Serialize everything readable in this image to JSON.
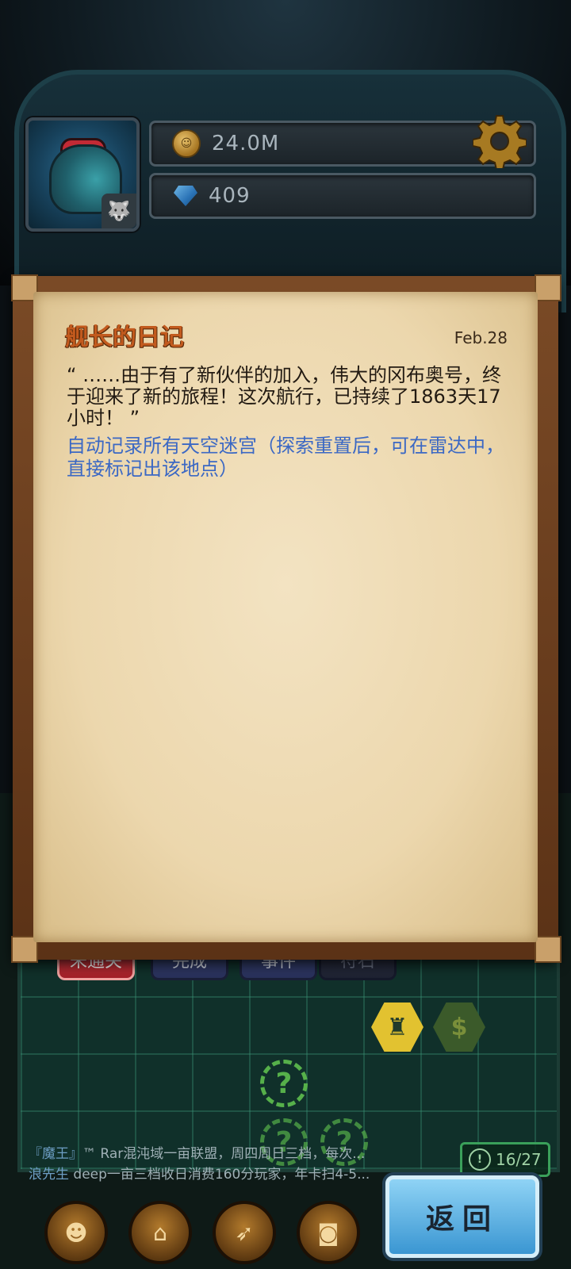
{
  "header": {
    "gold_value": "24.0M",
    "gem_value": "409",
    "icons": [
      "coin-icon",
      "gem-icon",
      "gear-icon",
      "wolf-badge-icon"
    ]
  },
  "diary": {
    "title": "舰长的日记",
    "date": "Feb.28",
    "text": "“ ……由于有了新伙伴的加入，伟大的冈布奥号，终于迎来了新的旅程！这次航行，已持续了1863天17小时！ ”",
    "note": "自动记录所有天空迷宫（探索重置后，可在雷达中，直接标记出该地点）"
  },
  "tabs": [
    {
      "label": "未通关",
      "state": "active"
    },
    {
      "label": "完成",
      "state": "normal"
    },
    {
      "label": "事件",
      "state": "normal"
    },
    {
      "label": "符石",
      "state": "dim"
    }
  ],
  "map": {
    "unknown_marker": "?",
    "currency_marker": "$"
  },
  "chat": [
    {
      "name": "『魔王』",
      "text": "™ Rar混沌域一亩联盟，周四周日三档，每次..."
    },
    {
      "name": "浪先生",
      "text": " deep一亩三档收日消费160分玩家，年卡扫4-5..."
    }
  ],
  "progress": {
    "value": "16/27"
  },
  "bottom_nav": [
    "slime-icon",
    "shop-icon",
    "rocket-icon",
    "bag-icon"
  ],
  "back_button": "返回",
  "colors": {
    "title_orange": "#c25a1e",
    "note_blue": "#3b68c4",
    "tab_red": "#c8313a",
    "back_blue": "#5bb0e0"
  }
}
